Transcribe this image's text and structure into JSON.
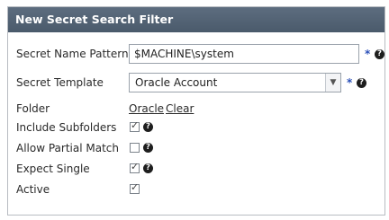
{
  "header": {
    "title": "New Secret Search Filter"
  },
  "fields": {
    "name_pattern": {
      "label": "Secret Name Pattern",
      "value": "$MACHINE\\system",
      "required": "*"
    },
    "template": {
      "label": "Secret Template",
      "value": "Oracle Account",
      "required": "*"
    },
    "folder": {
      "label": "Folder",
      "link": "Oracle",
      "clear": "Clear"
    },
    "include_subfolders": {
      "label": "Include Subfolders",
      "checked": true
    },
    "allow_partial": {
      "label": "Allow Partial Match",
      "checked": false
    },
    "expect_single": {
      "label": "Expect Single",
      "checked": true
    },
    "active": {
      "label": "Active",
      "checked": true
    }
  },
  "icons": {
    "help": "question-circle-icon",
    "checkmark": "check-icon",
    "dropdown": "chevron-down-icon"
  },
  "colors": {
    "header_bg": "#4f5f70",
    "required_star": "#2a4fb8"
  }
}
